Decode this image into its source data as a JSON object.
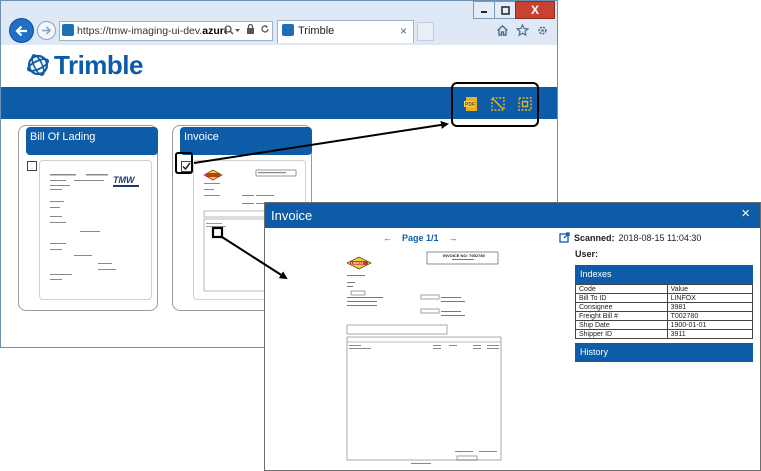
{
  "browser": {
    "url_prefix": "https://tmw-imaging-ui-dev.",
    "url_domain": "azurewe...",
    "tab_title": "Trimble",
    "close_symbol": "×",
    "window_close_symbol": "X"
  },
  "app": {
    "logo_text": "Trimble",
    "actions": [
      "pdf-icon",
      "crop-icon",
      "select-area-icon"
    ]
  },
  "documents": [
    {
      "title": "Bill Of Lading",
      "checked": false
    },
    {
      "title": "Invoice",
      "checked": true
    }
  ],
  "modal": {
    "title": "Invoice",
    "close_symbol": "×",
    "pager_label": "Page 1/1",
    "prev_symbol": "←",
    "next_symbol": "→",
    "scanned_label": "Scanned:",
    "scanned_value": "2018-08-15 11:04:30",
    "user_label": "User:",
    "indexes_title": "Indexes",
    "history_title": "History",
    "index_headers": [
      "Code",
      "Value"
    ],
    "index_rows": [
      [
        "Bill To ID",
        "LINFOX"
      ],
      [
        "Consignee",
        "3981"
      ],
      [
        "Freight Bill #",
        "T002780"
      ],
      [
        "Ship Date",
        "1900-01-01"
      ],
      [
        "Shipper ID",
        "3911"
      ]
    ]
  },
  "colors": {
    "brand_blue": "#0e5ca8",
    "icon_yellow": "#e8b31a",
    "close_red": "#c7432f"
  }
}
